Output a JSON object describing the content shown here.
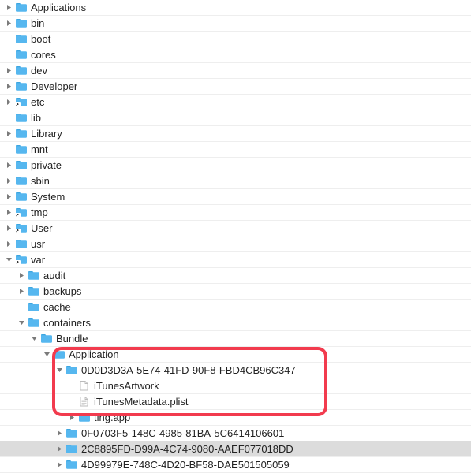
{
  "r0": {
    "label": "Applications"
  },
  "r1": {
    "label": "bin"
  },
  "r2": {
    "label": "boot"
  },
  "r3": {
    "label": "cores"
  },
  "r4": {
    "label": "dev"
  },
  "r5": {
    "label": "Developer"
  },
  "r6": {
    "label": "etc"
  },
  "r7": {
    "label": "lib"
  },
  "r8": {
    "label": "Library"
  },
  "r9": {
    "label": "mnt"
  },
  "r10": {
    "label": "private"
  },
  "r11": {
    "label": "sbin"
  },
  "r12": {
    "label": "System"
  },
  "r13": {
    "label": "tmp"
  },
  "r14": {
    "label": "User"
  },
  "r15": {
    "label": "usr"
  },
  "r16": {
    "label": "var"
  },
  "r17": {
    "label": "audit"
  },
  "r18": {
    "label": "backups"
  },
  "r19": {
    "label": "cache"
  },
  "r20": {
    "label": "containers"
  },
  "r21": {
    "label": "Bundle"
  },
  "r22": {
    "label": "Application"
  },
  "r23": {
    "label": "0D0D3D3A-5E74-41FD-90F8-FBD4CB96C347"
  },
  "r24": {
    "label": "iTunesArtwork"
  },
  "r25": {
    "label": "iTunesMetadata.plist"
  },
  "r26": {
    "label": "ting.app"
  },
  "r27": {
    "label": "0F0703F5-148C-4985-81BA-5C6414106601"
  },
  "r28": {
    "label": "2C8895FD-D99A-4C74-9080-AAEF077018DD"
  },
  "r29": {
    "label": "4D99979E-748C-4D20-BF58-DAE501505059"
  }
}
